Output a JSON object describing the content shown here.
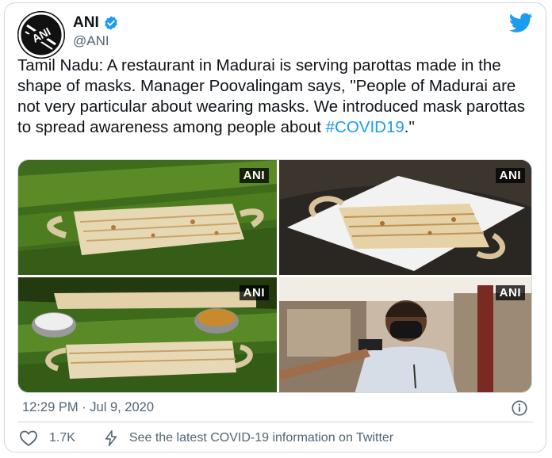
{
  "author": {
    "name": "ANI",
    "handle": "@ANI",
    "avatar_text": "ANI",
    "verified_icon": "verified-badge-icon",
    "brand_color": "#1d9bf0"
  },
  "tweet": {
    "text_main": "Tamil Nadu: A restaurant in Madurai is serving parottas made in the shape of masks. Manager Poovalingam says, \"People of Madurai are not very particular about wearing masks. We introduced mask parottas to spread awareness among people about ",
    "hashtag": "#COVID19",
    "text_end": ".\""
  },
  "media": {
    "images": [
      {
        "watermark": "ANI"
      },
      {
        "watermark": "ANI"
      },
      {
        "watermark": "ANI"
      },
      {
        "watermark": "ANI"
      }
    ]
  },
  "meta": {
    "timestamp": "12:29 PM · Jul 9, 2020"
  },
  "actions": {
    "like_count": "1.7K",
    "covid_info": "See the latest COVID-19 information on Twitter"
  }
}
